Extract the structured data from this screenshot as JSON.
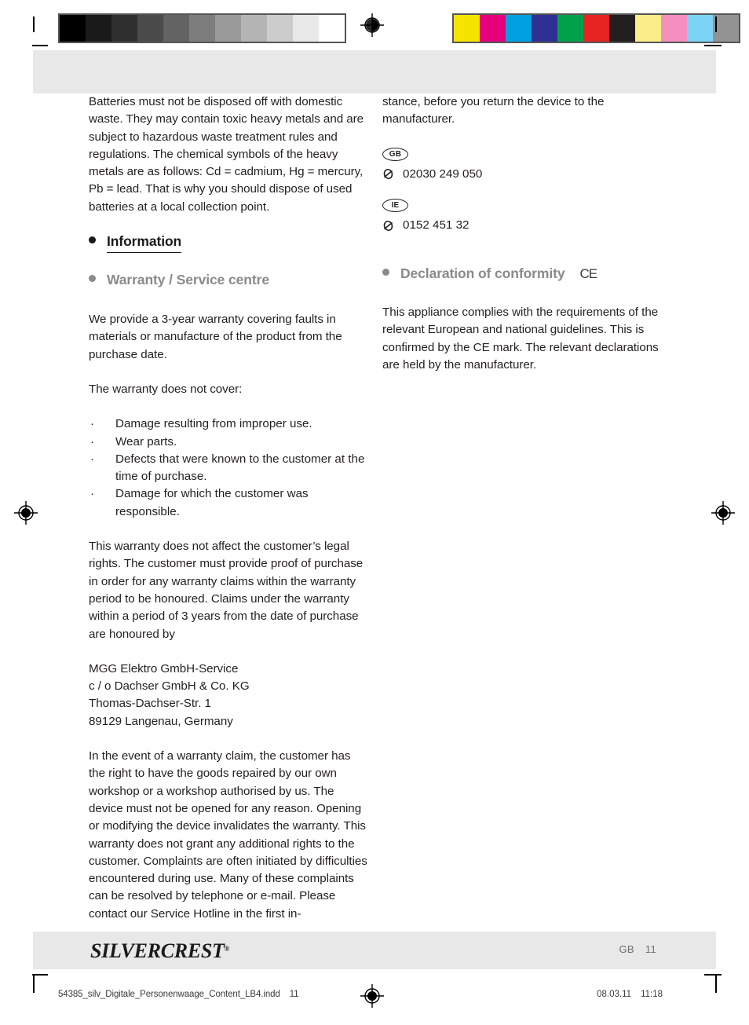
{
  "proof": {
    "gray_strip": [
      "#000000",
      "#1a1a1a",
      "#2f2f2f",
      "#4b4b4b",
      "#636363",
      "#7d7d7d",
      "#9a9a9a",
      "#b4b4b4",
      "#cccccc",
      "#e8e8e8",
      "#ffffff"
    ],
    "color_strip": [
      "#f5e400",
      "#e6007e",
      "#00a0e3",
      "#2e3192",
      "#00a14b",
      "#e52421",
      "#231f20",
      "#faed8a",
      "#f48fc0",
      "#7dd3f5",
      "#939393"
    ],
    "registration_marks": 4,
    "crop_marks": 8
  },
  "footer": {
    "brand_silver": "SILVER",
    "brand_crest": "CREST",
    "brand_registered": "®",
    "country_code": "GB",
    "page_number": "11"
  },
  "print_info": {
    "filename": "54385_silv_Digitale_Personenwaage_Content_LB4.indd",
    "page": "11",
    "date": "08.03.11",
    "time": "11:18"
  },
  "left_column": {
    "battery_paragraph": "Batteries must not be disposed off with domestic waste. They may contain toxic heavy metals and are subject to hazardous waste treatment rules and regulations. The chemical symbols of the heavy metals are as follows: Cd = cadmium, Hg = mercury, Pb = lead. That is why you should dispose of used batteries at a local collection point.",
    "heading_information": "Information",
    "heading_warranty": "Warranty / Service centre",
    "warranty_intro": "We provide a 3-year warranty covering faults in materials or manufacture of the product from the purchase date.",
    "exclusions_intro": "The warranty does not cover:",
    "exclusions_bullet": "·",
    "exclusions": [
      "Damage resulting from improper use.",
      "Wear parts.",
      "Defects that were known to the customer at the time of purchase.",
      "Damage for which the customer was responsible."
    ],
    "legal_rights_paragraph": "This warranty does not affect the customer’s legal rights. The customer must provide proof of purchase in order for any warranty claims within the warranty period to be honoured. Claims under the warranty within a period of 3 years from the date of purchase are honoured by",
    "address": [
      "MGG Elektro GmbH-Service",
      "c / o Dachser GmbH & Co. KG",
      "Thomas-Dachser-Str. 1",
      "89129 Langenau, Germany"
    ],
    "claim_paragraph": "In the event of a warranty claim, the customer has the right to have the goods repaired by our own workshop or a workshop authorised by us. The device must not be opened for any reason. Opening or modifying the device invalidates the warranty. This warranty does not grant any additional rights to the customer. Complaints are often initiated by difficulties encountered during use. Many of these complaints can be resolved by telephone or e-mail. Please contact our Service Hotline in the first in-"
  },
  "right_column": {
    "continuation_paragraph": "stance, before you return the device to the manufacturer.",
    "contacts": [
      {
        "country": "GB",
        "phone": "02030 249 050"
      },
      {
        "country": "IE",
        "phone": "0152 451 32"
      }
    ],
    "heading_declaration": "Declaration of conformity",
    "ce_mark": "CE",
    "declaration_paragraph": "This appliance complies with the requirements of the relevant European and national guidelines. This is confirmed by the CE mark. The relevant declarations are held by the manufacturer."
  }
}
